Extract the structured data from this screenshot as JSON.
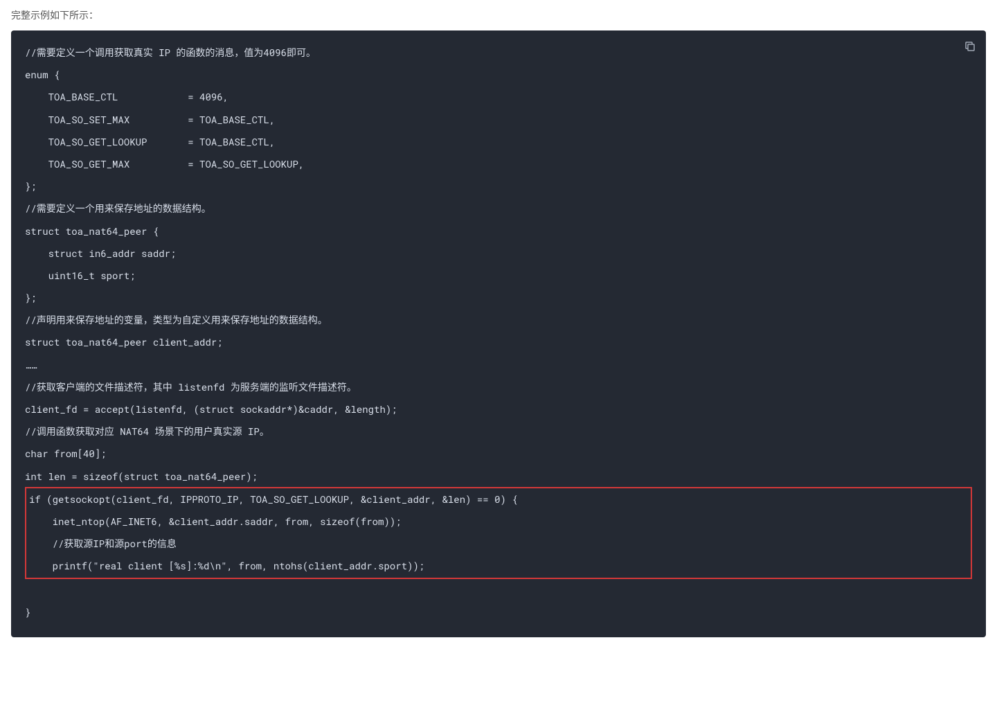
{
  "intro": "完整示例如下所示：",
  "code": {
    "l01": "//需要定义一个调用获取真实 IP 的函数的消息，值为4096即可。",
    "l02": "enum {",
    "l03": "    TOA_BASE_CTL            = 4096,",
    "l04": "    TOA_SO_SET_MAX          = TOA_BASE_CTL,",
    "l05": "    TOA_SO_GET_LOOKUP       = TOA_BASE_CTL,",
    "l06": "    TOA_SO_GET_MAX          = TOA_SO_GET_LOOKUP,",
    "l07": "};",
    "l08": "//需要定义一个用来保存地址的数据结构。",
    "l09": "struct toa_nat64_peer {",
    "l10": "    struct in6_addr saddr;",
    "l11": "    uint16_t sport;",
    "l12": "};",
    "l13": "//声明用来保存地址的变量，类型为自定义用来保存地址的数据结构。",
    "l14": "struct toa_nat64_peer client_addr;",
    "l15": "……",
    "l16": "//获取客户端的文件描述符，其中 listenfd 为服务端的监听文件描述符。",
    "l17": "client_fd = accept(listenfd, (struct sockaddr*)&caddr, &length);",
    "l18": "//调用函数获取对应 NAT64 场景下的用户真实源 IP。",
    "l19": "char from[40];",
    "l20": "int len = sizeof(struct toa_nat64_peer);",
    "h1": "if (getsockopt(client_fd, IPPROTO_IP, TOA_SO_GET_LOOKUP, &client_addr, &len) == 0) {",
    "h2": "    inet_ntop(AF_INET6, &client_addr.saddr, from, sizeof(from));",
    "h3": "    //获取源IP和源port的信息",
    "h4": "    printf(\"real client [%s]:%d\\n\", from, ntohs(client_addr.sport));",
    "l21": "}"
  }
}
